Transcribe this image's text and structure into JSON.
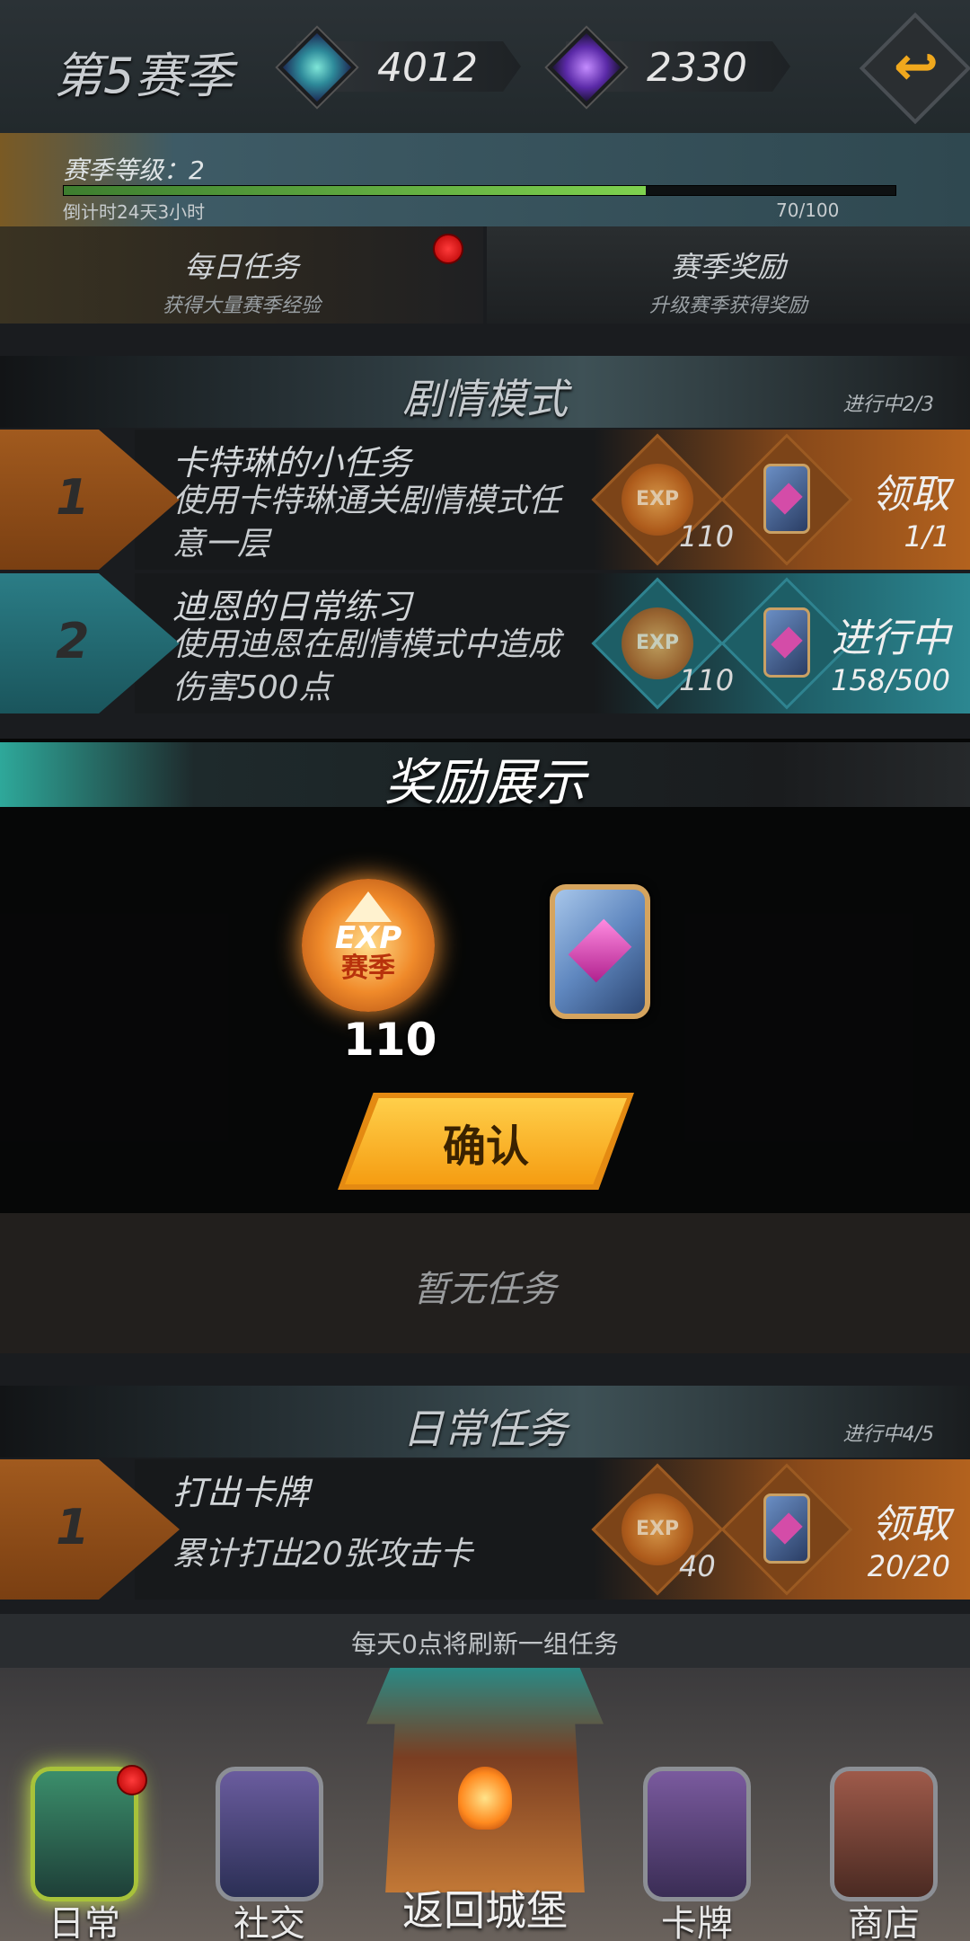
{
  "header": {
    "season_title": "第5赛季",
    "currency_1": {
      "icon": "crystal-coin-icon",
      "value": "4012"
    },
    "currency_2": {
      "icon": "purple-gem-icon",
      "value": "2330"
    },
    "back_icon": "return-arrow-icon"
  },
  "season": {
    "level_label": "赛季等级：2",
    "countdown": "倒计时24天3小时",
    "progress_text": "70/100",
    "progress_fraction": 0.7
  },
  "tabs": [
    {
      "title": "每日任务",
      "subtitle": "获得大量赛季经验",
      "has_badge": true
    },
    {
      "title": "赛季奖励",
      "subtitle": "升级赛季获得奖励"
    }
  ],
  "story_section": {
    "title": "剧情模式",
    "progress": "进行中2/3",
    "tasks": [
      {
        "number": "1",
        "name": "卡特琳的小任务",
        "desc": "使用卡特琳通关剧情模式任意一层",
        "exp": "110",
        "action": "领取",
        "ratio": "1/1",
        "theme": "orange"
      },
      {
        "number": "2",
        "name": "迪恩的日常练习",
        "desc": "使用迪恩在剧情模式中造成伤害500点",
        "exp": "110",
        "action": "进行中",
        "ratio": "158/500",
        "theme": "teal"
      }
    ]
  },
  "modal": {
    "title": "奖励展示",
    "exp_label_top": "EXP",
    "exp_label_bottom": "赛季",
    "exp_amount": "110",
    "confirm_label": "确认"
  },
  "empty_state": "暂无任务",
  "daily_section": {
    "title": "日常任务",
    "progress": "进行中4/5",
    "tasks": [
      {
        "number": "1",
        "name": "打出卡牌",
        "desc": "累计打出20张攻击卡",
        "exp": "40",
        "action": "领取",
        "ratio": "20/20",
        "theme": "orange"
      }
    ]
  },
  "footer_note": "每天0点将刷新一组任务",
  "nav": {
    "daily": "日常",
    "social": "社交",
    "castle": "返回城堡",
    "cards": "卡牌",
    "shop": "商店"
  }
}
